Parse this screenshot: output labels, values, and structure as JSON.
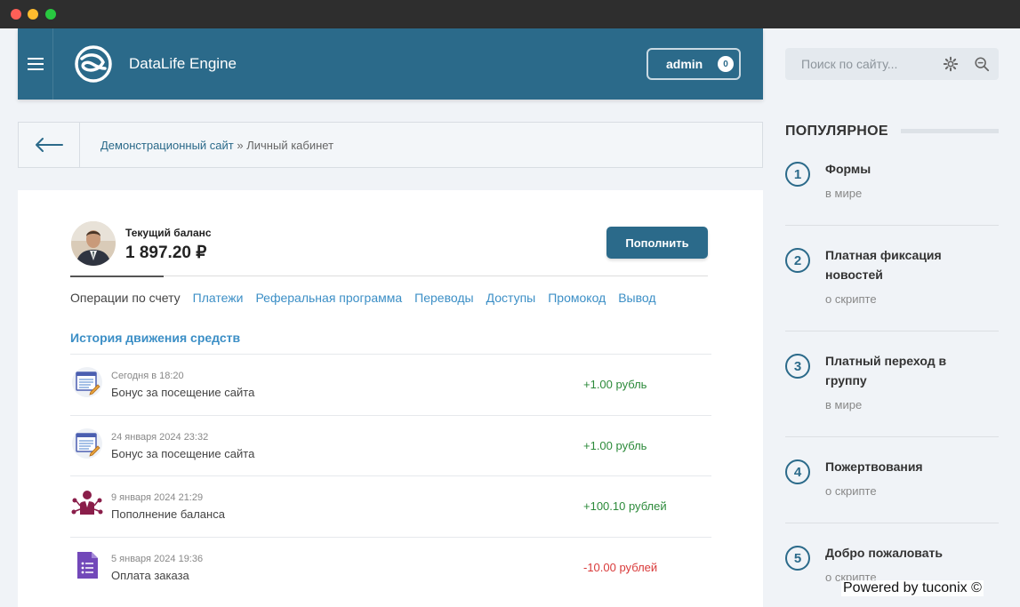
{
  "header": {
    "brand": "DataLife Engine",
    "user_label": "admin",
    "user_count": "0"
  },
  "search": {
    "placeholder": "Поиск по сайту..."
  },
  "breadcrumb": {
    "site": "Демонстрационный сайт",
    "separator": " » ",
    "current": "Личный кабинет"
  },
  "balance": {
    "label": "Текущий баланс",
    "value": "1 897.20 ₽",
    "topup_label": "Пополнить"
  },
  "tabs": [
    {
      "label": "Операции по счету",
      "active": true
    },
    {
      "label": "Платежи"
    },
    {
      "label": "Реферальная программа"
    },
    {
      "label": "Переводы"
    },
    {
      "label": "Доступы"
    },
    {
      "label": "Промокод"
    },
    {
      "label": "Вывод"
    }
  ],
  "history": {
    "title": "История движения средств",
    "rows": [
      {
        "icon": "document-pen-icon",
        "date": "Сегодня в 18:20",
        "desc": "Бонус за посещение сайта",
        "amount": "+1.00 рубль",
        "sign": "plus"
      },
      {
        "icon": "document-pen-icon",
        "date": "24 января 2024 23:32",
        "desc": "Бонус за посещение сайта",
        "amount": "+1.00 рубль",
        "sign": "plus"
      },
      {
        "icon": "person-network-icon",
        "date": "9 января 2024 21:29",
        "desc": "Пополнение баланса",
        "amount": "+100.10 рублей",
        "sign": "plus"
      },
      {
        "icon": "form-list-icon",
        "date": "5 января 2024 19:36",
        "desc": "Оплата заказа",
        "amount": "-10.00 рублей",
        "sign": "minus"
      }
    ]
  },
  "popular": {
    "title": "ПОПУЛЯРНОЕ",
    "items": [
      {
        "num": "1",
        "title": "Формы",
        "sub": "в мире"
      },
      {
        "num": "2",
        "title": "Платная фиксация новостей",
        "sub": "о скрипте"
      },
      {
        "num": "3",
        "title": "Платный переход в группу",
        "sub": "в мире"
      },
      {
        "num": "4",
        "title": "Пожертвования",
        "sub": "о скрипте"
      },
      {
        "num": "5",
        "title": "Добро пожаловать",
        "sub": "о скрипте"
      }
    ]
  },
  "footer": {
    "powered": "Powered by tuconix ©"
  },
  "colors": {
    "accent": "#2b6a8a",
    "link": "#3c8fc6",
    "positive": "#2c8a3a",
    "negative": "#d93a3a"
  }
}
